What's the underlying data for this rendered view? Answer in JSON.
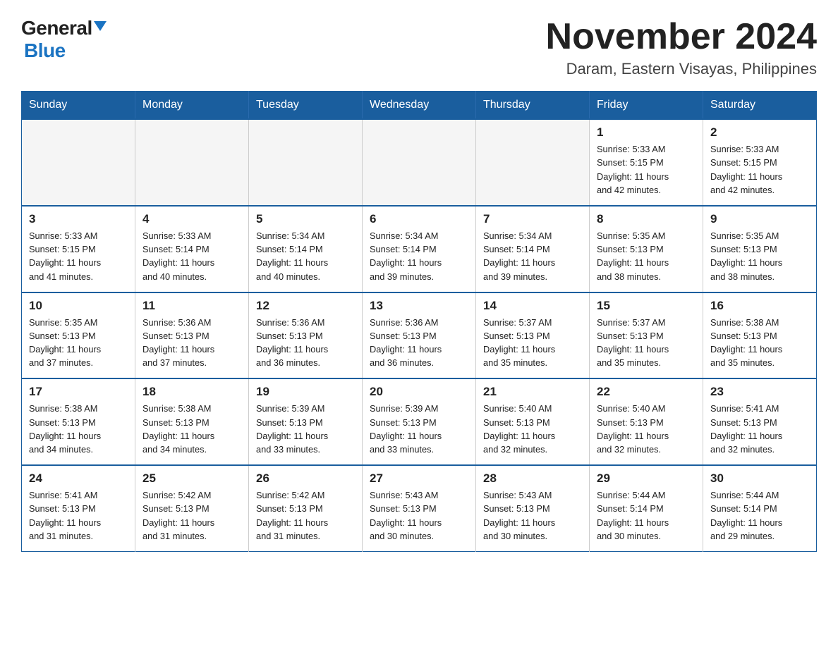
{
  "logo": {
    "general": "General",
    "blue": "Blue"
  },
  "header": {
    "title": "November 2024",
    "subtitle": "Daram, Eastern Visayas, Philippines"
  },
  "weekdays": [
    "Sunday",
    "Monday",
    "Tuesday",
    "Wednesday",
    "Thursday",
    "Friday",
    "Saturday"
  ],
  "weeks": [
    [
      {
        "day": "",
        "info": ""
      },
      {
        "day": "",
        "info": ""
      },
      {
        "day": "",
        "info": ""
      },
      {
        "day": "",
        "info": ""
      },
      {
        "day": "",
        "info": ""
      },
      {
        "day": "1",
        "info": "Sunrise: 5:33 AM\nSunset: 5:15 PM\nDaylight: 11 hours\nand 42 minutes."
      },
      {
        "day": "2",
        "info": "Sunrise: 5:33 AM\nSunset: 5:15 PM\nDaylight: 11 hours\nand 42 minutes."
      }
    ],
    [
      {
        "day": "3",
        "info": "Sunrise: 5:33 AM\nSunset: 5:15 PM\nDaylight: 11 hours\nand 41 minutes."
      },
      {
        "day": "4",
        "info": "Sunrise: 5:33 AM\nSunset: 5:14 PM\nDaylight: 11 hours\nand 40 minutes."
      },
      {
        "day": "5",
        "info": "Sunrise: 5:34 AM\nSunset: 5:14 PM\nDaylight: 11 hours\nand 40 minutes."
      },
      {
        "day": "6",
        "info": "Sunrise: 5:34 AM\nSunset: 5:14 PM\nDaylight: 11 hours\nand 39 minutes."
      },
      {
        "day": "7",
        "info": "Sunrise: 5:34 AM\nSunset: 5:14 PM\nDaylight: 11 hours\nand 39 minutes."
      },
      {
        "day": "8",
        "info": "Sunrise: 5:35 AM\nSunset: 5:13 PM\nDaylight: 11 hours\nand 38 minutes."
      },
      {
        "day": "9",
        "info": "Sunrise: 5:35 AM\nSunset: 5:13 PM\nDaylight: 11 hours\nand 38 minutes."
      }
    ],
    [
      {
        "day": "10",
        "info": "Sunrise: 5:35 AM\nSunset: 5:13 PM\nDaylight: 11 hours\nand 37 minutes."
      },
      {
        "day": "11",
        "info": "Sunrise: 5:36 AM\nSunset: 5:13 PM\nDaylight: 11 hours\nand 37 minutes."
      },
      {
        "day": "12",
        "info": "Sunrise: 5:36 AM\nSunset: 5:13 PM\nDaylight: 11 hours\nand 36 minutes."
      },
      {
        "day": "13",
        "info": "Sunrise: 5:36 AM\nSunset: 5:13 PM\nDaylight: 11 hours\nand 36 minutes."
      },
      {
        "day": "14",
        "info": "Sunrise: 5:37 AM\nSunset: 5:13 PM\nDaylight: 11 hours\nand 35 minutes."
      },
      {
        "day": "15",
        "info": "Sunrise: 5:37 AM\nSunset: 5:13 PM\nDaylight: 11 hours\nand 35 minutes."
      },
      {
        "day": "16",
        "info": "Sunrise: 5:38 AM\nSunset: 5:13 PM\nDaylight: 11 hours\nand 35 minutes."
      }
    ],
    [
      {
        "day": "17",
        "info": "Sunrise: 5:38 AM\nSunset: 5:13 PM\nDaylight: 11 hours\nand 34 minutes."
      },
      {
        "day": "18",
        "info": "Sunrise: 5:38 AM\nSunset: 5:13 PM\nDaylight: 11 hours\nand 34 minutes."
      },
      {
        "day": "19",
        "info": "Sunrise: 5:39 AM\nSunset: 5:13 PM\nDaylight: 11 hours\nand 33 minutes."
      },
      {
        "day": "20",
        "info": "Sunrise: 5:39 AM\nSunset: 5:13 PM\nDaylight: 11 hours\nand 33 minutes."
      },
      {
        "day": "21",
        "info": "Sunrise: 5:40 AM\nSunset: 5:13 PM\nDaylight: 11 hours\nand 32 minutes."
      },
      {
        "day": "22",
        "info": "Sunrise: 5:40 AM\nSunset: 5:13 PM\nDaylight: 11 hours\nand 32 minutes."
      },
      {
        "day": "23",
        "info": "Sunrise: 5:41 AM\nSunset: 5:13 PM\nDaylight: 11 hours\nand 32 minutes."
      }
    ],
    [
      {
        "day": "24",
        "info": "Sunrise: 5:41 AM\nSunset: 5:13 PM\nDaylight: 11 hours\nand 31 minutes."
      },
      {
        "day": "25",
        "info": "Sunrise: 5:42 AM\nSunset: 5:13 PM\nDaylight: 11 hours\nand 31 minutes."
      },
      {
        "day": "26",
        "info": "Sunrise: 5:42 AM\nSunset: 5:13 PM\nDaylight: 11 hours\nand 31 minutes."
      },
      {
        "day": "27",
        "info": "Sunrise: 5:43 AM\nSunset: 5:13 PM\nDaylight: 11 hours\nand 30 minutes."
      },
      {
        "day": "28",
        "info": "Sunrise: 5:43 AM\nSunset: 5:13 PM\nDaylight: 11 hours\nand 30 minutes."
      },
      {
        "day": "29",
        "info": "Sunrise: 5:44 AM\nSunset: 5:14 PM\nDaylight: 11 hours\nand 30 minutes."
      },
      {
        "day": "30",
        "info": "Sunrise: 5:44 AM\nSunset: 5:14 PM\nDaylight: 11 hours\nand 29 minutes."
      }
    ]
  ]
}
